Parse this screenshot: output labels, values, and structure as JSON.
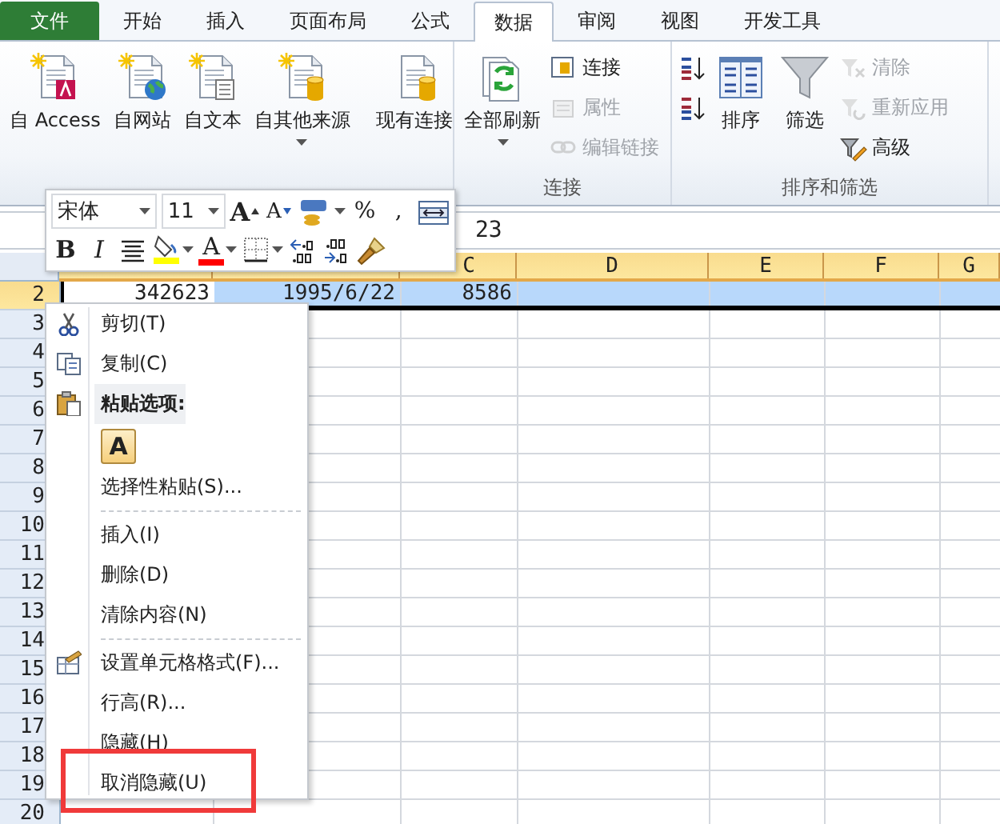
{
  "tabs": [
    {
      "label": "文件",
      "kind": "file",
      "selected": false
    },
    {
      "label": "开始",
      "kind": "tab",
      "selected": false
    },
    {
      "label": "插入",
      "kind": "tab",
      "selected": false
    },
    {
      "label": "页面布局",
      "kind": "tab",
      "selected": false
    },
    {
      "label": "公式",
      "kind": "tab",
      "selected": false
    },
    {
      "label": "数据",
      "kind": "tab",
      "selected": true
    },
    {
      "label": "审阅",
      "kind": "tab",
      "selected": false
    },
    {
      "label": "视图",
      "kind": "tab",
      "selected": false
    },
    {
      "label": "开发工具",
      "kind": "tab",
      "selected": false
    }
  ],
  "ribbon": {
    "groups": [
      {
        "items": [
          {
            "kind": "large",
            "label": "自 Access",
            "has_menu": false
          },
          {
            "kind": "large",
            "label": "自网站",
            "has_menu": false
          },
          {
            "kind": "large",
            "label": "自文本",
            "has_menu": false
          },
          {
            "kind": "large",
            "label": "自其他来源",
            "has_menu": true
          },
          {
            "kind": "separator"
          },
          {
            "kind": "large",
            "label": "现有连接",
            "has_menu": false
          }
        ]
      },
      {
        "label": "连接",
        "items": [
          {
            "kind": "large",
            "label": "全部刷新",
            "has_menu": true
          },
          {
            "kind": "stack",
            "items": [
              {
                "label": "连接",
                "disabled": false
              },
              {
                "label": "属性",
                "disabled": true
              },
              {
                "label": "编辑链接",
                "disabled": true
              }
            ]
          }
        ]
      },
      {
        "label": "排序和筛选",
        "items": [
          {
            "kind": "stack",
            "items": [
              {
                "disabled": false
              },
              {
                "disabled": false
              }
            ]
          },
          {
            "kind": "large",
            "label": "排序",
            "has_menu": false
          },
          {
            "kind": "large",
            "label": "筛选",
            "has_menu": false
          },
          {
            "kind": "stack",
            "items": [
              {
                "label": "清除",
                "disabled": true
              },
              {
                "label": "重新应用",
                "disabled": true
              },
              {
                "label": "高级",
                "disabled": false
              }
            ]
          }
        ]
      }
    ]
  },
  "formula_bar": {
    "value": "23"
  },
  "column_headers": [
    {
      "label": "C"
    },
    {
      "label": "D"
    },
    {
      "label": "E"
    },
    {
      "label": "F"
    },
    {
      "label": "G"
    }
  ],
  "rows": [
    {
      "number": "2",
      "selected": true,
      "cells": [
        "342623",
        "1995/6/22",
        "8586"
      ]
    },
    {
      "number": "3",
      "selected": false
    },
    {
      "number": "4",
      "selected": false
    },
    {
      "number": "5",
      "selected": false
    },
    {
      "number": "6",
      "selected": false
    },
    {
      "number": "7",
      "selected": false
    },
    {
      "number": "8",
      "selected": false
    },
    {
      "number": "9",
      "selected": false
    },
    {
      "number": "10",
      "selected": false
    },
    {
      "number": "11",
      "selected": false
    },
    {
      "number": "12",
      "selected": false
    },
    {
      "number": "13",
      "selected": false
    },
    {
      "number": "14",
      "selected": false
    },
    {
      "number": "15",
      "selected": false
    },
    {
      "number": "16",
      "selected": false
    },
    {
      "number": "17",
      "selected": false
    },
    {
      "number": "18",
      "selected": false
    },
    {
      "number": "19",
      "selected": false
    },
    {
      "number": "20",
      "selected": false
    }
  ],
  "mini_toolbar": {
    "rows": [
      [
        {
          "kind": "font_field",
          "value": "宋体"
        },
        {
          "kind": "size_field",
          "value": "11"
        },
        {
          "kind": "grow_font",
          "glyph": "A"
        },
        {
          "kind": "shrink_font",
          "glyph": "A"
        },
        {
          "kind": "accounting",
          "has_menu": true
        },
        {
          "kind": "glyph",
          "glyph": "%"
        },
        {
          "kind": "glyph",
          "glyph": ","
        },
        {
          "kind": "merge"
        }
      ],
      [
        {
          "kind": "bold",
          "glyph": "B"
        },
        {
          "kind": "italic",
          "glyph": "I"
        },
        {
          "kind": "align"
        },
        {
          "kind": "fill_color",
          "color": "#ffff00",
          "has_menu": true
        },
        {
          "kind": "font_color",
          "glyph": "A",
          "color": "#ff0000",
          "has_menu": true
        },
        {
          "kind": "borders",
          "has_menu": true
        },
        {
          "kind": "increase_decimal"
        },
        {
          "kind": "decrease_decimal"
        },
        {
          "kind": "format_painter"
        }
      ]
    ]
  },
  "context_menu": {
    "items": [
      {
        "kind": "cut",
        "label": "剪切(T)",
        "annotated": false
      },
      {
        "kind": "copy",
        "label": "复制(C)",
        "annotated": false
      },
      {
        "kind": "header",
        "label": "粘贴选项:",
        "annotated": false
      },
      {
        "kind": "tile",
        "glyph": "A"
      },
      {
        "kind": "item",
        "label": "选择性粘贴(S)...",
        "annotated": false
      },
      {
        "kind": "separator"
      },
      {
        "kind": "item",
        "label": "插入(I)",
        "annotated": false
      },
      {
        "kind": "item",
        "label": "删除(D)",
        "annotated": false
      },
      {
        "kind": "item",
        "label": "清除内容(N)",
        "annotated": false
      },
      {
        "kind": "separator"
      },
      {
        "kind": "format",
        "label": "设置单元格格式(F)...",
        "annotated": false
      },
      {
        "kind": "item",
        "label": "行高(R)...",
        "annotated": false
      },
      {
        "kind": "item",
        "label": "隐藏(H)",
        "annotated": false
      },
      {
        "kind": "item",
        "label": "取消隐藏(U)",
        "annotated": true
      }
    ]
  }
}
